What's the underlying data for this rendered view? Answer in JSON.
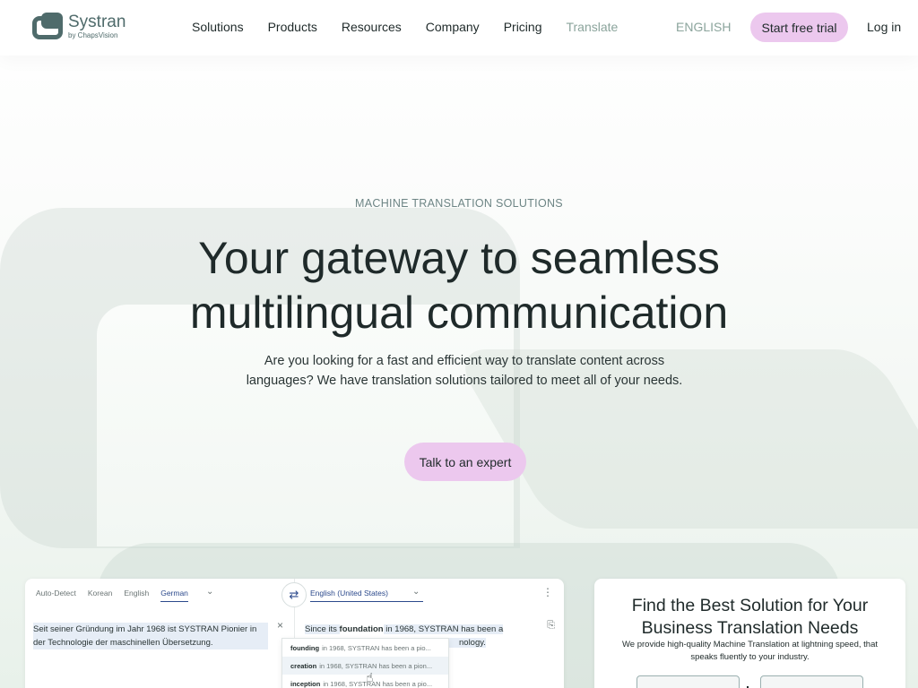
{
  "header": {
    "brand": "Systran",
    "brand_sub": "by ChapsVision",
    "nav": [
      "Solutions",
      "Products",
      "Resources",
      "Company",
      "Pricing",
      "Translate"
    ],
    "language": "ENGLISH",
    "trial_label": "Start free trial",
    "login_label": "Log in"
  },
  "hero": {
    "eyebrow": "MACHINE TRANSLATION SOLUTIONS",
    "headline_line1": "Your gateway to seamless",
    "headline_line2": "multilingual communication",
    "subtext": "Are you looking for a fast and efficient way to translate content across languages? We have translation solutions tailored to meet all of your needs.",
    "cta_label": "Talk to an expert"
  },
  "translator": {
    "source_tabs": [
      "Auto-Detect",
      "Korean",
      "English",
      "German"
    ],
    "target_language": "English (United States)",
    "source_text": "Seit seiner Gründung im Jahr 1968 ist SYSTRAN Pionier in der Technologie der maschinellen Übersetzung.",
    "target_prefix": "Since its ",
    "target_highlight": "foundation",
    "target_suffix": " in 1968, SYSTRAN has been a",
    "target_tail": "nology.",
    "suggestions": [
      {
        "word": "founding",
        "rest": "in 1968, SYSTRAN has been a pio..."
      },
      {
        "word": "creation",
        "rest": "in 1968, SYSTRAN has been a pion..."
      },
      {
        "word": "inception",
        "rest": "in 1968, SYSTRAN has been a pio..."
      }
    ]
  },
  "card": {
    "title": "Find the Best Solution for Your Business Translation Needs",
    "subtitle": "We provide high-quality Machine Translation at lightning speed, that speaks fluently to your industry."
  }
}
